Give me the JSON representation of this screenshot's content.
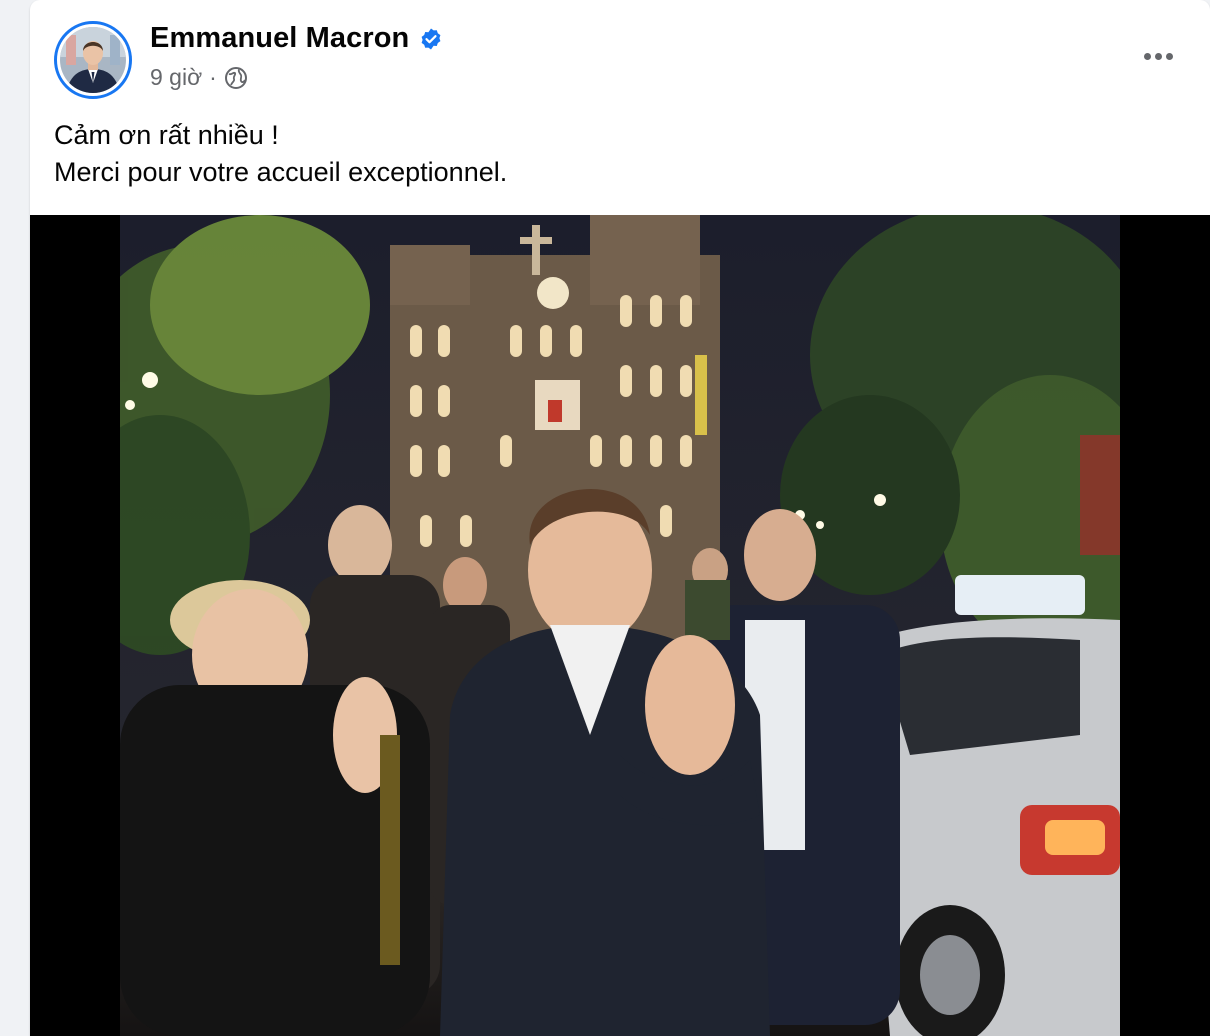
{
  "post": {
    "author": "Emmanuel Macron",
    "verified_icon": "verified-badge-icon",
    "time": "9 giờ",
    "separator": "·",
    "privacy_icon": "globe-icon",
    "more_icon": "more-options-icon",
    "text_lines": [
      "Cảm ơn rất nhiều !",
      "Merci pour votre accueil exceptionnel."
    ]
  },
  "colors": {
    "accent": "#1877f2",
    "primary_text": "#050505",
    "secondary_text": "#65676b"
  }
}
